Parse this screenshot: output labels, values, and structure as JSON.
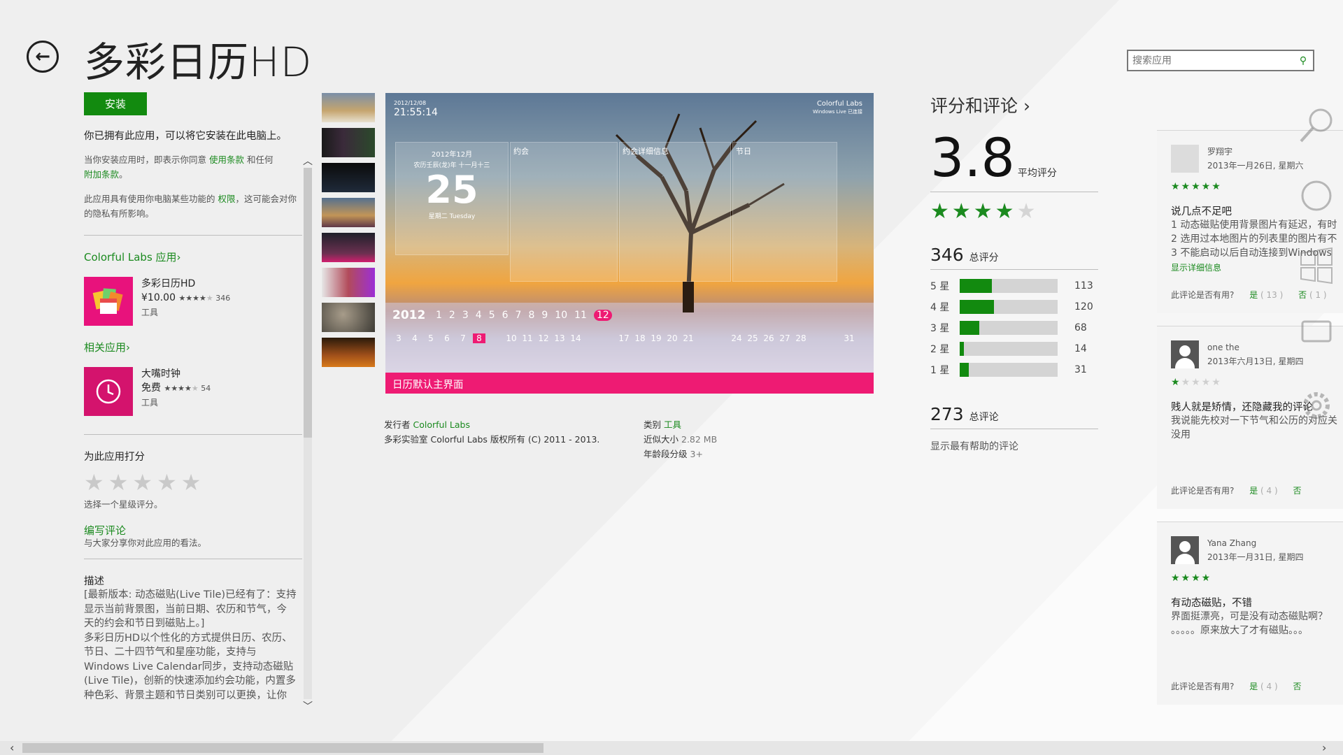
{
  "header": {
    "app_title": "多彩日历HD"
  },
  "left": {
    "install_label": "安装",
    "owned_text": "你已拥有此应用，可以将它安装在此电脑上。",
    "terms_prefix": "当你安装应用时，即表示你同意",
    "terms_link": "使用条款",
    "terms_mid": "和任何",
    "extra_terms_link": "附加条款",
    "terms_end": "。",
    "perm_prefix": "此应用具有使用你电脑某些功能的",
    "perm_link": "权限",
    "perm_suffix": "，这可能会对你的隐私有所影响。",
    "publisher_apps_label": "Colorful Labs 应用",
    "app1": {
      "name": "多彩日历HD",
      "price": "¥10.00",
      "stars": "★★★★",
      "stars_off": "★",
      "count": "346",
      "category": "工具",
      "tile_color": "#e8127c"
    },
    "related_label": "相关应用",
    "app2": {
      "name": "大嘴时钟",
      "price": "免费",
      "stars": "★★★★",
      "stars_off": "★",
      "count": "54",
      "category": "工具",
      "tile_color": "#d4136d"
    },
    "rate_label": "为此应用打分",
    "rate_hint": "选择一个星级评分。",
    "write_review_label": "编写评论",
    "write_review_hint": "与大家分享你对此应用的看法。",
    "desc_title": "描述",
    "desc_lines": [
      "[最新版本: 动态磁贴(Live Tile)已经有了：支持",
      "显示当前背景图，当前日期、农历和节气，今",
      "天的约会和节日到磁贴上。]",
      "多彩日历HD以个性化的方式提供日历、农历、",
      "节日、二十四节气和星座功能，支持与",
      "Windows Live Calendar同步，支持动态磁贴",
      "(Live Tile)，创新的快速添加约会功能，内置多",
      "种色彩、背景主题和节日类别可以更换，让你"
    ]
  },
  "screenshot": {
    "caption": "日历默认主界面",
    "date_small": "2012/12/08",
    "time": "21:55:14",
    "brand": "Colorful Labs",
    "brand_sub": "Windows Live 已连接",
    "month": "2012年12月",
    "lunar": "农历壬辰(龙)年 十一月十三",
    "day": "25",
    "weekday": "星期二 Tuesday",
    "panel_appt": "约会",
    "panel_detail": "约会详细信息",
    "panel_festival": "节日",
    "year_label": "2012",
    "months": [
      "1",
      "2",
      "3",
      "4",
      "5",
      "6",
      "7",
      "8",
      "9",
      "10",
      "11",
      "12"
    ],
    "days": [
      "3",
      "4",
      "5",
      "6",
      "7",
      "8",
      "",
      "10",
      "11",
      "12",
      "13",
      "14",
      "",
      "",
      "17",
      "18",
      "19",
      "20",
      "21",
      "",
      "",
      "24",
      "25",
      "26",
      "27",
      "28",
      "",
      "",
      "31"
    ]
  },
  "publisher": {
    "publisher_label": "发行者",
    "publisher_name": "Colorful Labs",
    "copyright": "多彩实验室 Colorful Labs 版权所有 (C) 2011 - 2013.",
    "category_label": "类别",
    "category_value": "工具",
    "size_label": "近似大小",
    "size_value": "2.82 MB",
    "age_label": "年龄段分级",
    "age_value": "3+"
  },
  "ratings": {
    "title": "评分和评论",
    "average": "3.8",
    "average_label": "平均评分",
    "stars_on": "★★★★",
    "stars_off": "★",
    "total_ratings": "346",
    "total_ratings_label": "总评分",
    "breakdown": [
      {
        "label": "5 星",
        "count": "113",
        "fraction": 0.33
      },
      {
        "label": "4 星",
        "count": "120",
        "fraction": 0.35
      },
      {
        "label": "3 星",
        "count": "68",
        "fraction": 0.2
      },
      {
        "label": "2 星",
        "count": "14",
        "fraction": 0.04
      },
      {
        "label": "1 星",
        "count": "31",
        "fraction": 0.09
      }
    ],
    "total_reviews": "273",
    "total_reviews_label": "总评论",
    "helpful_link": "显示最有帮助的评论"
  },
  "search": {
    "placeholder": "搜索应用"
  },
  "reviews": [
    {
      "author": "罗翔宇",
      "date": "2013年一月26日, 星期六",
      "stars_on": "★★★★★",
      "stars_off": "",
      "title": "说几点不足吧",
      "body": [
        "1 动态磁贴使用背景图片有延迟，有时",
        "2 选用过本地图片的列表里的图片有不",
        "3 不能启动以后自动连接到Windows"
      ],
      "more": "显示详细信息",
      "helpful_q": "此评论是否有用?",
      "yes": "是",
      "yes_count": "( 13 )",
      "no": "否",
      "no_count": "( 1 )"
    },
    {
      "author": "one the",
      "date": "2013年六月13日, 星期四",
      "stars_on": "★",
      "stars_off": "★★★★",
      "title": "贱人就是矫情，还隐藏我的评论",
      "body": [
        "我说能先校对一下节气和公历的对应关",
        "没用"
      ],
      "more": "",
      "helpful_q": "此评论是否有用?",
      "yes": "是",
      "yes_count": "( 4 )",
      "no": "否",
      "no_count": ""
    },
    {
      "author": "Yana Zhang",
      "date": "2013年一月31日, 星期四",
      "stars_on": "★★★★",
      "stars_off": "",
      "title": "有动态磁贴，不错",
      "body": [
        "界面挺漂亮，可是没有动态磁贴啊？",
        "。。。。。原来放大了才有磁贴。。。"
      ],
      "more": "",
      "helpful_q": "此评论是否有用?",
      "yes": "是",
      "yes_count": "( 4 )",
      "no": "否",
      "no_count": ""
    }
  ],
  "colors": {
    "accent_green": "#128a0f",
    "caption_pink": "#ee1b73"
  }
}
